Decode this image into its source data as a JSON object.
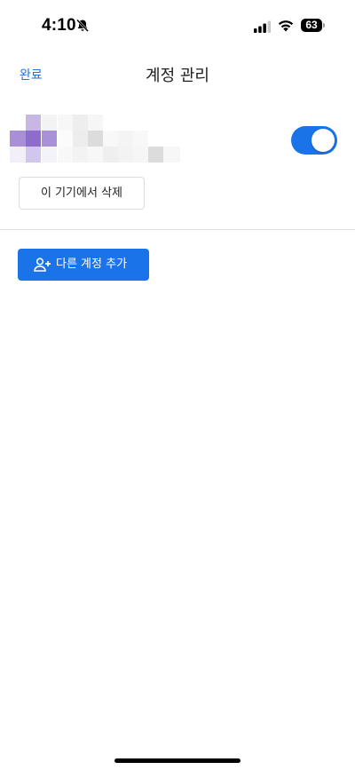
{
  "status_bar": {
    "time": "4:10",
    "battery_level": "63",
    "icons": [
      "bell-off-icon",
      "signal-icon",
      "wifi-icon",
      "battery-icon"
    ]
  },
  "nav": {
    "done_label": "완료",
    "title": "계정 관리"
  },
  "account": {
    "sync_enabled": true,
    "remove_label": "이 기기에서 삭제"
  },
  "actions": {
    "add_account_label": "다른 계정 추가",
    "add_account_icon": "person-add-icon"
  },
  "colors": {
    "accent": "#1a73e8",
    "text": "#202124",
    "divider": "#e0e0e0",
    "button_border": "#dadce0"
  }
}
